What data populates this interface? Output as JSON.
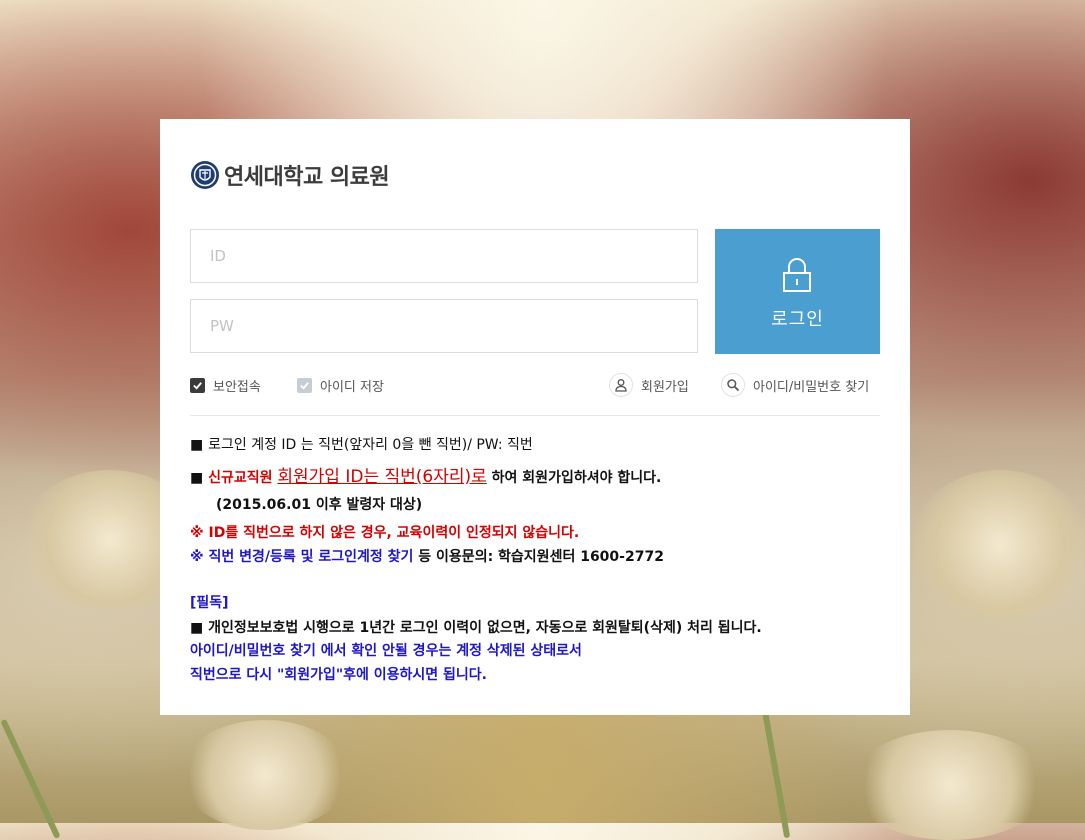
{
  "logo": {
    "title": "연세대학교 의료원"
  },
  "login": {
    "id_placeholder": "ID",
    "pw_placeholder": "PW",
    "button_label": "로그인"
  },
  "options": {
    "secure_access": "보안접속",
    "save_id": "아이디 저장",
    "signup": "회원가입",
    "find_account": "아이디/비밀번호 찾기"
  },
  "notices": {
    "line1": {
      "bullet": "■",
      "text": "로그인 계정 ID 는 직번(앞자리 0을 뺀 직번)/ PW: 직번"
    },
    "line2": {
      "bullet": "■",
      "prefix": "신규교직원",
      "highlight": "회원가입 ID는 직번(6자리)로",
      "suffix": "하여 회원가입하셔야 합니다."
    },
    "line3": "(2015.06.01 이후 발령자 대상)",
    "line4": "※ ID를 직번으로 하지 않은 경우, 교육이력이 인정되지 않습니다.",
    "line5": {
      "blue": "※ 직번 변경/등록 및 로그인계정 찾기",
      "rest": "등 이용문의: 학습지원센터 1600-2772"
    },
    "must_read_label": "[필독]",
    "line6": {
      "bullet": "■",
      "text": "개인정보보호법 시행으로 1년간 로그인 이력이 없으면, 자동으로 회원탈퇴(삭제) 처리 됩니다."
    },
    "line7": "아이디/비밀번호 찾기 에서 확인 안될 경우는 계정 삭제된 상태로서",
    "line8": "직번으로 다시 \"회원가입\"후에 이용하시면 됩니다."
  },
  "colors": {
    "accent": "#4a9fd0",
    "warning_red": "#d40000",
    "info_blue": "#1e16c7"
  }
}
